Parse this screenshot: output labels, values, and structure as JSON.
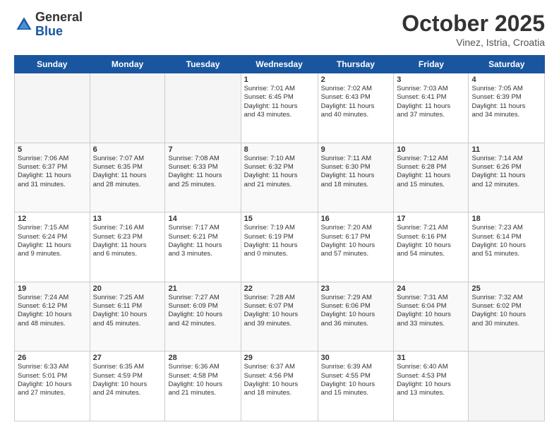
{
  "header": {
    "logo_general": "General",
    "logo_blue": "Blue",
    "month_title": "October 2025",
    "location": "Vinez, Istria, Croatia"
  },
  "days_of_week": [
    "Sunday",
    "Monday",
    "Tuesday",
    "Wednesday",
    "Thursday",
    "Friday",
    "Saturday"
  ],
  "weeks": [
    [
      {
        "day": "",
        "info": ""
      },
      {
        "day": "",
        "info": ""
      },
      {
        "day": "",
        "info": ""
      },
      {
        "day": "1",
        "info": "Sunrise: 7:01 AM\nSunset: 6:45 PM\nDaylight: 11 hours\nand 43 minutes."
      },
      {
        "day": "2",
        "info": "Sunrise: 7:02 AM\nSunset: 6:43 PM\nDaylight: 11 hours\nand 40 minutes."
      },
      {
        "day": "3",
        "info": "Sunrise: 7:03 AM\nSunset: 6:41 PM\nDaylight: 11 hours\nand 37 minutes."
      },
      {
        "day": "4",
        "info": "Sunrise: 7:05 AM\nSunset: 6:39 PM\nDaylight: 11 hours\nand 34 minutes."
      }
    ],
    [
      {
        "day": "5",
        "info": "Sunrise: 7:06 AM\nSunset: 6:37 PM\nDaylight: 11 hours\nand 31 minutes."
      },
      {
        "day": "6",
        "info": "Sunrise: 7:07 AM\nSunset: 6:35 PM\nDaylight: 11 hours\nand 28 minutes."
      },
      {
        "day": "7",
        "info": "Sunrise: 7:08 AM\nSunset: 6:33 PM\nDaylight: 11 hours\nand 25 minutes."
      },
      {
        "day": "8",
        "info": "Sunrise: 7:10 AM\nSunset: 6:32 PM\nDaylight: 11 hours\nand 21 minutes."
      },
      {
        "day": "9",
        "info": "Sunrise: 7:11 AM\nSunset: 6:30 PM\nDaylight: 11 hours\nand 18 minutes."
      },
      {
        "day": "10",
        "info": "Sunrise: 7:12 AM\nSunset: 6:28 PM\nDaylight: 11 hours\nand 15 minutes."
      },
      {
        "day": "11",
        "info": "Sunrise: 7:14 AM\nSunset: 6:26 PM\nDaylight: 11 hours\nand 12 minutes."
      }
    ],
    [
      {
        "day": "12",
        "info": "Sunrise: 7:15 AM\nSunset: 6:24 PM\nDaylight: 11 hours\nand 9 minutes."
      },
      {
        "day": "13",
        "info": "Sunrise: 7:16 AM\nSunset: 6:23 PM\nDaylight: 11 hours\nand 6 minutes."
      },
      {
        "day": "14",
        "info": "Sunrise: 7:17 AM\nSunset: 6:21 PM\nDaylight: 11 hours\nand 3 minutes."
      },
      {
        "day": "15",
        "info": "Sunrise: 7:19 AM\nSunset: 6:19 PM\nDaylight: 11 hours\nand 0 minutes."
      },
      {
        "day": "16",
        "info": "Sunrise: 7:20 AM\nSunset: 6:17 PM\nDaylight: 10 hours\nand 57 minutes."
      },
      {
        "day": "17",
        "info": "Sunrise: 7:21 AM\nSunset: 6:16 PM\nDaylight: 10 hours\nand 54 minutes."
      },
      {
        "day": "18",
        "info": "Sunrise: 7:23 AM\nSunset: 6:14 PM\nDaylight: 10 hours\nand 51 minutes."
      }
    ],
    [
      {
        "day": "19",
        "info": "Sunrise: 7:24 AM\nSunset: 6:12 PM\nDaylight: 10 hours\nand 48 minutes."
      },
      {
        "day": "20",
        "info": "Sunrise: 7:25 AM\nSunset: 6:11 PM\nDaylight: 10 hours\nand 45 minutes."
      },
      {
        "day": "21",
        "info": "Sunrise: 7:27 AM\nSunset: 6:09 PM\nDaylight: 10 hours\nand 42 minutes."
      },
      {
        "day": "22",
        "info": "Sunrise: 7:28 AM\nSunset: 6:07 PM\nDaylight: 10 hours\nand 39 minutes."
      },
      {
        "day": "23",
        "info": "Sunrise: 7:29 AM\nSunset: 6:06 PM\nDaylight: 10 hours\nand 36 minutes."
      },
      {
        "day": "24",
        "info": "Sunrise: 7:31 AM\nSunset: 6:04 PM\nDaylight: 10 hours\nand 33 minutes."
      },
      {
        "day": "25",
        "info": "Sunrise: 7:32 AM\nSunset: 6:02 PM\nDaylight: 10 hours\nand 30 minutes."
      }
    ],
    [
      {
        "day": "26",
        "info": "Sunrise: 6:33 AM\nSunset: 5:01 PM\nDaylight: 10 hours\nand 27 minutes."
      },
      {
        "day": "27",
        "info": "Sunrise: 6:35 AM\nSunset: 4:59 PM\nDaylight: 10 hours\nand 24 minutes."
      },
      {
        "day": "28",
        "info": "Sunrise: 6:36 AM\nSunset: 4:58 PM\nDaylight: 10 hours\nand 21 minutes."
      },
      {
        "day": "29",
        "info": "Sunrise: 6:37 AM\nSunset: 4:56 PM\nDaylight: 10 hours\nand 18 minutes."
      },
      {
        "day": "30",
        "info": "Sunrise: 6:39 AM\nSunset: 4:55 PM\nDaylight: 10 hours\nand 15 minutes."
      },
      {
        "day": "31",
        "info": "Sunrise: 6:40 AM\nSunset: 4:53 PM\nDaylight: 10 hours\nand 13 minutes."
      },
      {
        "day": "",
        "info": ""
      }
    ]
  ]
}
